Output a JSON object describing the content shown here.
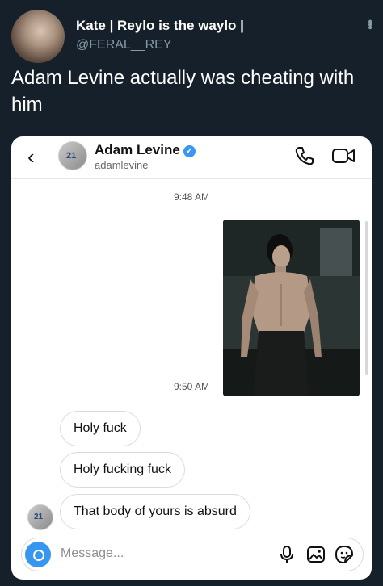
{
  "tweet": {
    "display_name": "Kate | Reylo is the waylo |",
    "handle": "@FERAL__REY",
    "text": "Adam Levine actually was cheating with him",
    "avatar_icon": "profile-photo",
    "more_icon": "more-vertical-icon"
  },
  "dm": {
    "contact_name": "Adam Levine",
    "contact_username": "adamlevine",
    "verified": true,
    "accent_color": "#3897f0",
    "timestamps": [
      "9:48 AM",
      "9:50 AM"
    ],
    "messages": [
      "Holy fuck",
      "Holy fucking fuck",
      "That body of yours is absurd"
    ],
    "composer_placeholder": "Message...",
    "jersey_number": "21"
  }
}
